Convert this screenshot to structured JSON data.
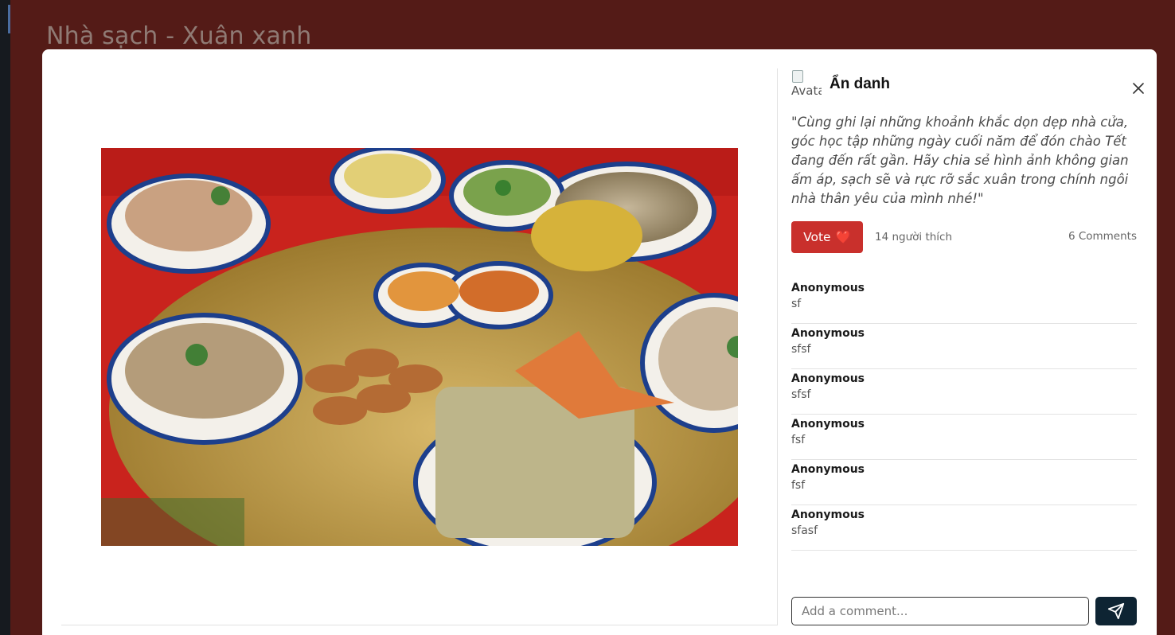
{
  "background_page": {
    "title": "Nhà sạch - Xuân xanh"
  },
  "post": {
    "image_alt": "Mâm cỗ ngày Tết",
    "author": {
      "avatar_alt": "Avatar",
      "name": "Ẩn danh"
    },
    "caption": "\"Cùng ghi lại những khoảnh khắc dọn dẹp nhà cửa, góc học tập những ngày cuối năm để đón chào Tết đang đến rất gần. Hãy chia sẻ hình ảnh không gian ấm áp, sạch sẽ và rực rỡ sắc xuân trong chính ngôi nhà thân yêu của mình nhé!\"",
    "vote_label": "Vote",
    "vote_emoji": "❤️",
    "likes_text": "14 người thích",
    "comments_count_text": "6 Comments"
  },
  "comments": [
    {
      "author": "Anonymous",
      "text": "sf"
    },
    {
      "author": "Anonymous",
      "text": "sfsf"
    },
    {
      "author": "Anonymous",
      "text": "sfsf"
    },
    {
      "author": "Anonymous",
      "text": "fsf"
    },
    {
      "author": "Anonymous",
      "text": "fsf"
    },
    {
      "author": "Anonymous",
      "text": "sfasf"
    }
  ],
  "composer": {
    "placeholder": "Add a comment...",
    "value": ""
  },
  "icons": {
    "close": "close-icon",
    "send": "send-icon"
  },
  "colors": {
    "backdrop": "#541b17",
    "vote_button": "#c9302c",
    "send_button": "#0e2433"
  }
}
